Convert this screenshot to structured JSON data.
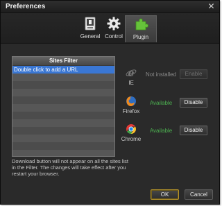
{
  "window": {
    "title": "Preferences"
  },
  "tabs": [
    {
      "label": "General",
      "icon": "general-settings-icon",
      "active": false
    },
    {
      "label": "Control",
      "icon": "gear-icon",
      "active": false
    },
    {
      "label": "Plugin",
      "icon": "puzzle-piece-icon",
      "active": true
    }
  ],
  "filter": {
    "header": "Sites Filter",
    "rows": [
      "Double click to add a URL",
      "",
      "",
      "",
      "",
      "",
      "",
      "",
      "",
      "",
      "",
      ""
    ]
  },
  "browsers": [
    {
      "name": "IE",
      "icon": "internet-explorer-icon",
      "status": "Not installed",
      "button": "Enable",
      "enabled": false
    },
    {
      "name": "Firefox",
      "icon": "firefox-icon",
      "status": "Available",
      "button": "Disable",
      "enabled": true
    },
    {
      "name": "Chrome",
      "icon": "chrome-icon",
      "status": "Available",
      "button": "Disable",
      "enabled": true
    }
  ],
  "info_text": "Download button will not appear on all the sites list in the Filter. The changes will take effect after you restart your browser.",
  "buttons": {
    "ok": "OK",
    "cancel": "Cancel"
  },
  "colors": {
    "status_available": "#4caf50",
    "status_not_installed": "#8a8a8a",
    "selection": "#3a77d4",
    "ok_border": "#b8962a"
  }
}
